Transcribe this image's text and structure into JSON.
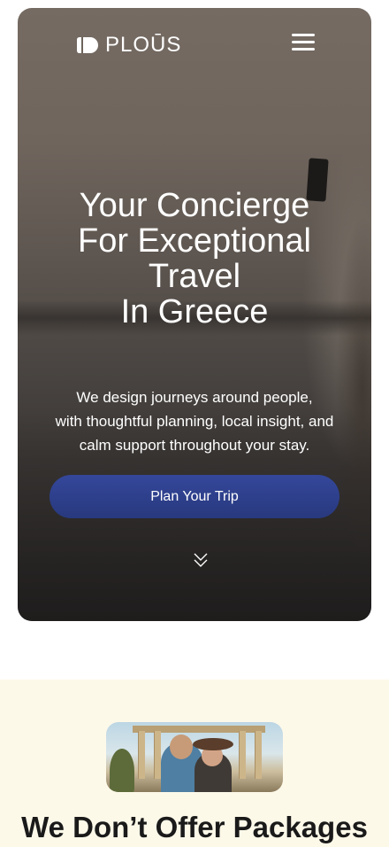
{
  "brand": {
    "name": "PLOŪS"
  },
  "hero": {
    "title_lines": [
      "Your Concierge",
      "For Exceptional",
      "Travel",
      "In Greece"
    ],
    "subtitle_lines": [
      "We design journeys around people,",
      "with thoughtful planning, local insight, and",
      "calm support throughout your stay."
    ],
    "cta_label": "Plan Your Trip"
  },
  "section": {
    "title_regular": "We Don’t",
    "title_bold": "Offer Packages"
  },
  "colors": {
    "cta": "#2f4290",
    "section_bg": "#fdf9e9",
    "text_light": "#ffffff",
    "text_dark": "#1a1a1a"
  },
  "icons": {
    "menu": "hamburger-menu-icon",
    "scroll": "double-chevron-down-icon"
  }
}
